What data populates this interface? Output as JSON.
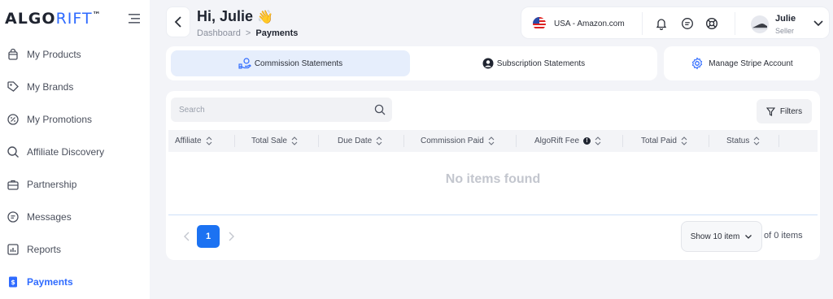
{
  "brand": {
    "logo_part1": "ALGO",
    "logo_part2": "RIFT",
    "tm": "™"
  },
  "sidebar": {
    "items": [
      {
        "label": "My Products",
        "icon": "bag-icon"
      },
      {
        "label": "My Brands",
        "icon": "tag-icon"
      },
      {
        "label": "My Promotions",
        "icon": "discount-icon"
      },
      {
        "label": "Affiliate Discovery",
        "icon": "search-icon"
      },
      {
        "label": "Partnership",
        "icon": "briefcase-icon"
      },
      {
        "label": "Messages",
        "icon": "chat-icon"
      },
      {
        "label": "Reports",
        "icon": "report-icon"
      },
      {
        "label": "Payments",
        "icon": "payment-icon",
        "active": true
      }
    ]
  },
  "header": {
    "greeting": "Hi, Julie",
    "wave_emoji": "👋",
    "breadcrumb": {
      "parent": "Dashboard",
      "separator": ">",
      "current": "Payments"
    }
  },
  "topbar": {
    "marketplace": "USA - Amazon.com",
    "user_name": "Julie",
    "user_role": "Seller"
  },
  "tabs": [
    {
      "label": "Commission Statements",
      "active": true
    },
    {
      "label": "Subscription Statements",
      "active": false
    }
  ],
  "stripe_button": {
    "label": "Manage Stripe Account"
  },
  "table": {
    "search_placeholder": "Search",
    "filters_label": "Filters",
    "columns": [
      "Affiliate",
      "Total Sale",
      "Due Date",
      "Commission Paid",
      "AlgoRift Fee",
      "Total Paid",
      "Status"
    ],
    "info_marker": "!",
    "empty_text": "No items found"
  },
  "pagination": {
    "current_page": "1",
    "per_page_label": "Show 10 item",
    "total_label": "of 0 items"
  },
  "colors": {
    "accent": "#2f6bff",
    "page_button": "#1c72f2",
    "active_tab_bg": "#e6eefc",
    "background": "#f3f4f8"
  }
}
